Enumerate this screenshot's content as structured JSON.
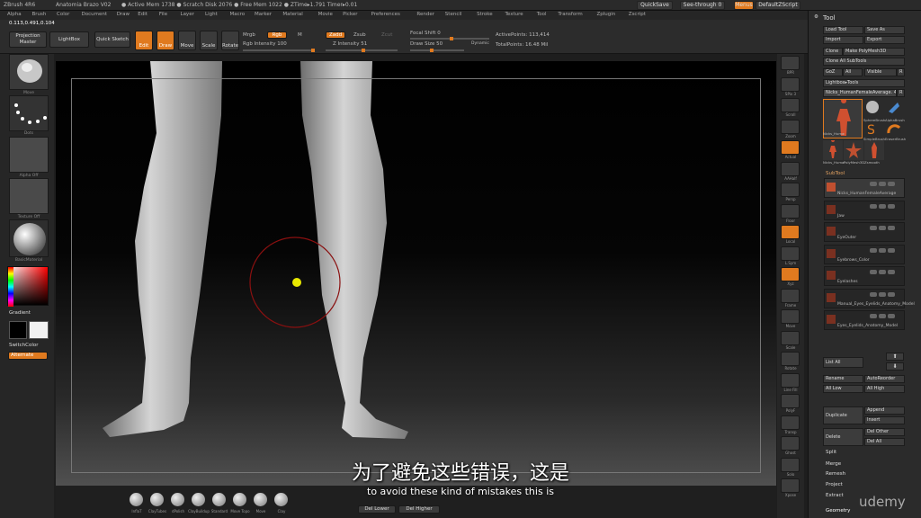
{
  "titlebar": {
    "app": "ZBrush 4R6",
    "doc": "Anatomia Brazo V02",
    "info": "● Active Mem 1738 ● Scratch Disk 2076 ● Free Mem 1022 ● ZTime▸1.791 Timer▸0.01",
    "quicksave": "QuickSave",
    "seethrough": "See-through 0",
    "menus": "Menus",
    "script": "DefaultZScript"
  },
  "menubar": [
    "Alpha",
    "Brush",
    "Color",
    "Document",
    "Draw",
    "Edit",
    "File",
    "Layer",
    "Light",
    "Macro",
    "Marker",
    "Material",
    "Movie",
    "Picker",
    "Preferences",
    "Render",
    "Stencil",
    "Stroke",
    "Texture",
    "Tool",
    "Transform",
    "Zplugin",
    "Zscript"
  ],
  "coords": "0.113,0.491,0.104",
  "toolbar": {
    "projection_master": "Projection Master",
    "lightbox": "LightBox",
    "quick_sketch": "Quick Sketch",
    "edit": "Edit",
    "draw": "Draw",
    "move": "Move",
    "scale": "Scale",
    "rotate": "Rotate",
    "mrgb": "Mrgb",
    "rgb": "Rgb",
    "m": "M",
    "zadd": "Zadd",
    "zsub": "Zsub",
    "zcut": "Zcut",
    "rgb_intensity": "Rgb Intensity 100",
    "z_intensity": "Z Intensity 51",
    "focal_shift": "Focal Shift 0",
    "draw_size": "Draw Size 50",
    "dynamic": "Dynamic",
    "active_points": "ActivePoints: 113,414",
    "total_points": "TotalPoints: 16.48 Mil"
  },
  "leftshelf": {
    "brush": "Move",
    "stroke": "Dots",
    "alpha": "Alpha Off",
    "texture": "Texture Off",
    "material": "BasicMaterial",
    "gradient": "Gradient",
    "switchcolor": "SwitchColor",
    "alternate": "Alternate"
  },
  "rightshelf": [
    "BPR",
    "SPix 3",
    "Scroll",
    "Zoom",
    "Actual",
    "AAHalf",
    "Persp",
    "Floor",
    "Local",
    "L.Sym",
    "Xyz",
    "Frame",
    "Move",
    "Scale",
    "Rotate",
    "Line Fill",
    "PolyF",
    "Transp",
    "Ghost",
    "Solo",
    "Xpose"
  ],
  "toolpanel": {
    "title": "Tool",
    "load_tool": "Load Tool",
    "save_as": "Save As",
    "import": "Import",
    "export": "Export",
    "clone": "Clone",
    "make_polymesh": "Make PolyMesh3D",
    "clone_all": "Clone All SubTools",
    "goz": "GoZ",
    "all": "All",
    "visible": "Visible",
    "r": "R",
    "lightbox_tools": "Lightbox▸Tools",
    "current_tool": "Nicks_HumanFemaleAverage. 48",
    "tool_thumbs": [
      "Nicks_HumanFem",
      "SphereBrush",
      "AlphaBrush",
      "SimpleBrush",
      "EraserBrush",
      "Nicks_HumanFem",
      "PolyMesh3D",
      "Zsmooth"
    ],
    "subtool_header": "SubTool",
    "subtools": [
      "Nicks_HumanFemaleAverage",
      "Jaw",
      "EyeOuter",
      "Eyebrows_Color",
      "Eyelashes",
      "Manual_Eyes_Eyelids_Anatomy_Model",
      "Eyes_Eyelids_Anatomy_Model"
    ],
    "list_all": "List All",
    "rename": "Rename",
    "autoreorder": "AutoReorder",
    "all_low": "All Low",
    "all_high": "All High",
    "duplicate": "Duplicate",
    "append": "Append",
    "insert": "Insert",
    "delete": "Delete",
    "del_other": "Del Other",
    "del_all": "Del All",
    "split": "Split",
    "merge": "Merge",
    "remesh": "Remesh",
    "project": "Project",
    "extract": "Extract",
    "geometry": "Geometry"
  },
  "bottombar": {
    "brushes": [
      "InflaT",
      "ClayTubes",
      "dPolish",
      "ClayBuildup",
      "Standard",
      "Move Topo",
      "Move",
      "Clay"
    ],
    "del_lower": "Del Lower",
    "del_higher": "Del Higher"
  },
  "subtitle_cn": "为了避免这些错误，这是",
  "subtitle_en": "to avoid these kind of mistakes this is",
  "watermark": "udemy"
}
